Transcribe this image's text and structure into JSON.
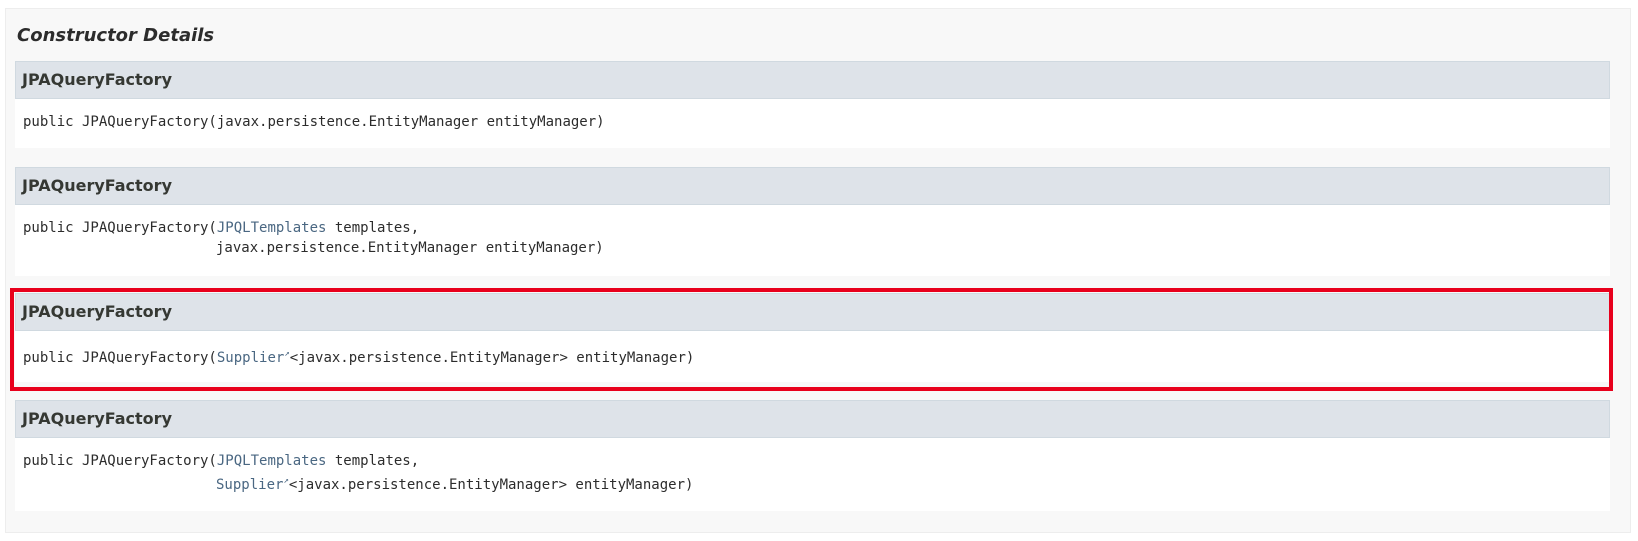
{
  "section": {
    "title": "Constructor Details"
  },
  "constructors": [
    {
      "name": "JPAQueryFactory",
      "line1_prefix": "public JPAQueryFactory(",
      "line1_suffix": "javax.persistence.EntityManager entityManager)"
    },
    {
      "name": "JPAQueryFactory",
      "line1_prefix": "public JPAQueryFactory(",
      "line1_link": "JPQLTemplates",
      "line1_suffix": " templates,",
      "line2_suffix": "javax.persistence.EntityManager entityManager)"
    },
    {
      "name": "JPAQueryFactory",
      "line1_prefix": "public JPAQueryFactory(",
      "line1_link": "Supplier",
      "line1_suffix": "<javax.persistence.EntityManager> entityManager)"
    },
    {
      "name": "JPAQueryFactory",
      "line1_prefix": "public JPAQueryFactory(",
      "line1_link": "JPQLTemplates",
      "line1_suffix": " templates,",
      "line2_link": "Supplier",
      "line2_suffix": "<javax.persistence.EntityManager> entityManager)"
    }
  ],
  "highlight": {
    "color": "#e8001c",
    "target": "constructors.2"
  },
  "colors": {
    "section_bg": "#f8f8f8",
    "header_bg": "#dee3e9",
    "link": "#4a6782"
  },
  "icons": {
    "external_link": "external-link-icon"
  }
}
